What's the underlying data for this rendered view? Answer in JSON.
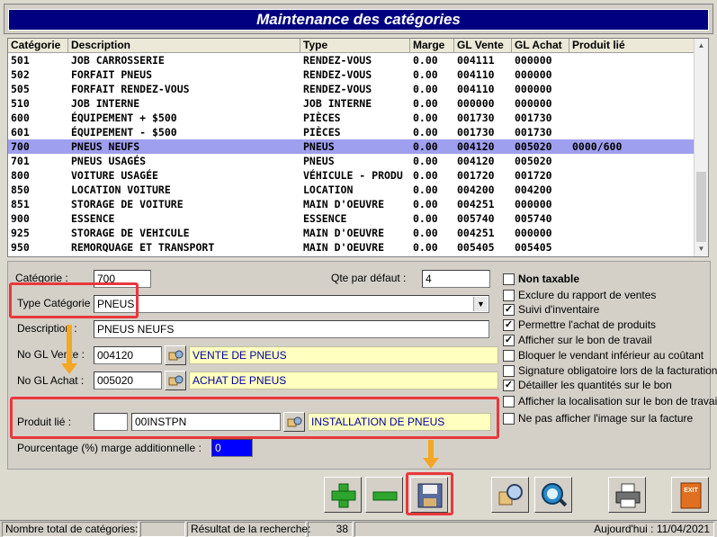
{
  "window": {
    "title": "Maintenance des catégories"
  },
  "grid": {
    "columns": [
      "Catégorie",
      "Description",
      "Type",
      "Marge",
      "GL Vente",
      "GL Achat",
      "Produit lié"
    ],
    "rows": [
      [
        "501",
        "JOB CARROSSERIE",
        "RENDEZ-VOUS",
        "0.00",
        "004111",
        "000000",
        ""
      ],
      [
        "502",
        "FORFAIT PNEUS",
        "RENDEZ-VOUS",
        "0.00",
        "004110",
        "000000",
        ""
      ],
      [
        "505",
        "FORFAIT RENDEZ-VOUS",
        "RENDEZ-VOUS",
        "0.00",
        "004110",
        "000000",
        ""
      ],
      [
        "510",
        "JOB INTERNE",
        "JOB INTERNE",
        "0.00",
        "000000",
        "000000",
        ""
      ],
      [
        "600",
        "ÉQUIPEMENT + $500",
        "PIÈCES",
        "0.00",
        "001730",
        "001730",
        ""
      ],
      [
        "601",
        "ÉQUIPEMENT - $500",
        "PIÈCES",
        "0.00",
        "001730",
        "001730",
        ""
      ],
      [
        "700",
        "PNEUS NEUFS",
        "PNEUS",
        "0.00",
        "004120",
        "005020",
        "0000/600"
      ],
      [
        "701",
        "PNEUS USAGÉS",
        "PNEUS",
        "0.00",
        "004120",
        "005020",
        ""
      ],
      [
        "800",
        "VOITURE USAGÉE",
        "VÉHICULE - PRODU",
        "0.00",
        "001720",
        "001720",
        ""
      ],
      [
        "850",
        "LOCATION VOITURE",
        "LOCATION",
        "0.00",
        "004200",
        "004200",
        ""
      ],
      [
        "851",
        "STORAGE DE VOITURE",
        "MAIN D'OEUVRE",
        "0.00",
        "004251",
        "000000",
        ""
      ],
      [
        "900",
        "ESSENCE",
        "ESSENCE",
        "0.00",
        "005740",
        "005740",
        ""
      ],
      [
        "925",
        "STORAGE DE VEHICULE",
        "MAIN D'OEUVRE",
        "0.00",
        "004251",
        "000000",
        ""
      ],
      [
        "950",
        "REMORQUAGE ET TRANSPORT",
        "MAIN D'OEUVRE",
        "0.00",
        "005405",
        "005405",
        ""
      ]
    ],
    "selected_row_index": 6,
    "selected_color": "#9f9ff0"
  },
  "form": {
    "categorie_label": "Catégorie :",
    "categorie_value": "700",
    "qte_label": "Qte par défaut :",
    "qte_value": "4",
    "type_label": "Type Catégorie :",
    "type_value": "PNEUS",
    "description_label": "Description :",
    "description_value": "PNEUS NEUFS",
    "gl_vente_label": "No GL Vente :",
    "gl_vente_value": "004120",
    "gl_vente_desc": "VENTE DE PNEUS",
    "gl_achat_label": "No GL Achat :",
    "gl_achat_value": "005020",
    "gl_achat_desc": "ACHAT DE PNEUS",
    "produit_label": "Produit lié :",
    "produit_prefix": "",
    "produit_code": "00INSTPN",
    "produit_desc": "INSTALLATION DE PNEUS",
    "pourcentage_label": "Pourcentage (%) marge additionnelle :",
    "pourcentage_value": "0"
  },
  "options": [
    {
      "label": "Non taxable",
      "checked": false,
      "bold": true
    },
    {
      "label": "Exclure du rapport de ventes",
      "checked": false
    },
    {
      "label": "Suivi d'inventaire",
      "checked": true
    },
    {
      "label": "Permettre l'achat de produits",
      "checked": true
    },
    {
      "label": "Afficher sur le bon de travail",
      "checked": true
    },
    {
      "label": "Bloquer le vendant inférieur au coûtant",
      "checked": false
    },
    {
      "label": "Signature obligatoire lors de la facturation",
      "checked": false
    },
    {
      "label": "Détailler les quantités sur le bon",
      "checked": true
    },
    {
      "label": "Afficher la localisation sur le bon de travail",
      "checked": false
    },
    {
      "label": "Ne pas afficher l'image sur la facture",
      "checked": false
    }
  ],
  "toolbar": {
    "add_icon": "plus-icon",
    "remove_icon": "minus-icon",
    "save_icon": "floppy-disk-icon",
    "search_icon": "magnifier-icon",
    "find_icon": "search-eye-icon",
    "print_icon": "printer-icon",
    "exit_icon": "exit-door-icon",
    "exit_text": "EXIT"
  },
  "status": {
    "total_label": "Nombre total de catégories:",
    "total_value": "",
    "result_label": "Résultat de la recherche:",
    "result_value": "38",
    "date_text": "Aujourd'hui : 11/04/2021"
  },
  "colors": {
    "title_bg": "#000080",
    "highlight": "#e8383c",
    "arrow": "#f5a623",
    "yellow_field": "#ffffc0"
  }
}
